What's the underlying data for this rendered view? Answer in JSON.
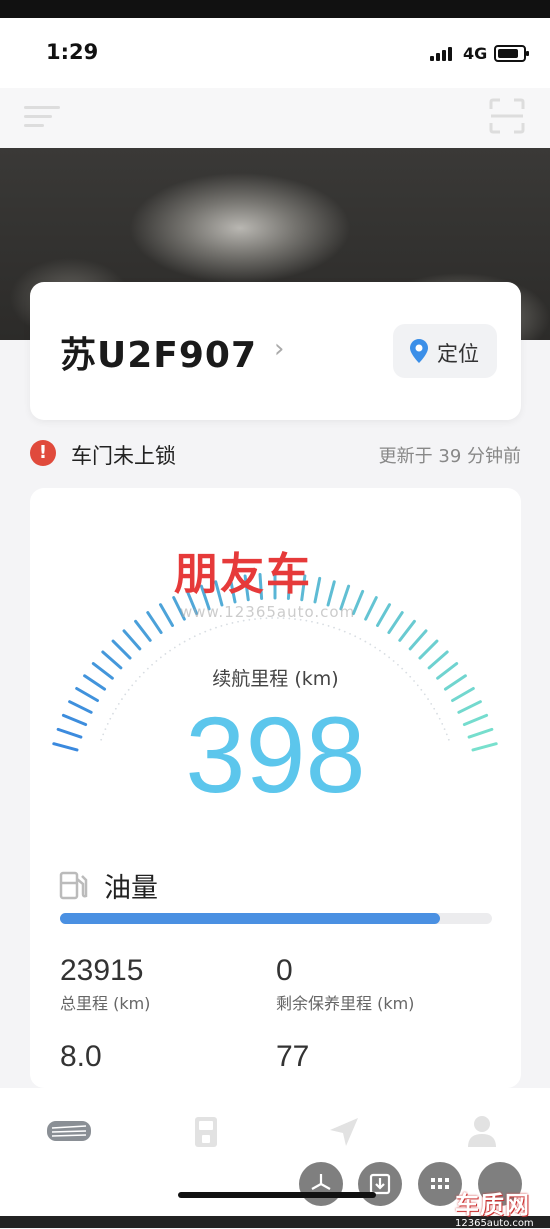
{
  "status_bar": {
    "time": "1:29",
    "network": "4G"
  },
  "vehicle": {
    "plate": "苏U2F907",
    "locate_label": "定位"
  },
  "alert": {
    "message": "车门未上锁",
    "updated": "更新于 39 分钟前"
  },
  "watermark": "www.12365auto.com",
  "range": {
    "label": "续航里程 (km)",
    "value": "398"
  },
  "fuel": {
    "label": "油量",
    "level_percent": 88
  },
  "stats": [
    {
      "value": "23915",
      "label": "总里程 (km)"
    },
    {
      "value": "0",
      "label": "剩余保养里程 (km)"
    },
    {
      "value": "8.0",
      "label": ""
    },
    {
      "value": "77",
      "label": ""
    }
  ],
  "stamp": "朋友车",
  "logo": {
    "title": "车质网",
    "url": "12365auto.com"
  },
  "colors": {
    "accent": "#5cc6ec",
    "fuel_bar": "#4a90e2",
    "alert": "#e04a3c",
    "stamp": "#e63a3a"
  },
  "icons": [
    "menu-icon",
    "scan-icon",
    "location-pin-icon",
    "warning-icon",
    "fuel-pump-icon",
    "car-brand-icon",
    "fuel-station-icon",
    "navigate-icon",
    "profile-icon",
    "fan-icon",
    "download-icon",
    "grid-icon"
  ]
}
